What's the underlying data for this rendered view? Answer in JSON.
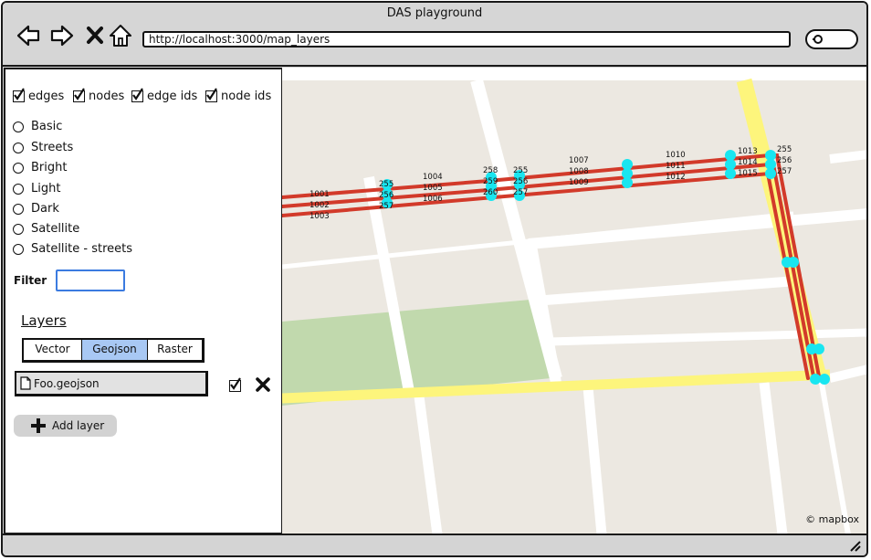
{
  "window": {
    "title": "DAS playground"
  },
  "toolbar": {
    "url": "http://localhost:3000/map_layers",
    "icons": [
      "back-arrow-icon",
      "forward-arrow-icon",
      "close-icon",
      "home-icon",
      "search-icon"
    ]
  },
  "sidebar": {
    "toggles": [
      {
        "label": "edges",
        "checked": true
      },
      {
        "label": "nodes",
        "checked": true
      },
      {
        "label": "edge ids",
        "checked": true
      },
      {
        "label": "node ids",
        "checked": true
      }
    ],
    "styles": [
      {
        "label": "Basic",
        "selected": false
      },
      {
        "label": "Streets",
        "selected": false
      },
      {
        "label": "Bright",
        "selected": false
      },
      {
        "label": "Light",
        "selected": false
      },
      {
        "label": "Dark",
        "selected": false
      },
      {
        "label": "Satellite",
        "selected": false
      },
      {
        "label": "Satellite - streets",
        "selected": false
      }
    ],
    "filter": {
      "label": "Filter",
      "value": ""
    },
    "layers": {
      "heading": "Layers",
      "tabs": [
        {
          "label": "Vector",
          "active": false
        },
        {
          "label": "Geojson",
          "active": true
        },
        {
          "label": "Raster",
          "active": false
        }
      ],
      "items": [
        {
          "name": "Foo.geojson",
          "visible": true
        }
      ],
      "add_label": "Add layer"
    }
  },
  "map": {
    "attribution": "© mapbox",
    "colors": {
      "edge": "#d23a2a",
      "node": "#19e6f0",
      "major_road": "#fdf57c",
      "park": "#c1d9ad",
      "land": "#ece8e1",
      "street": "#ffffff"
    },
    "edge_ids": {
      "west": [
        "1001",
        "1002",
        "1003"
      ],
      "mid": [
        "1004",
        "1005",
        "1006"
      ],
      "center": [
        "1007",
        "1008",
        "1009"
      ],
      "east": [
        "1010",
        "1011",
        "1012"
      ],
      "far_east": [
        "1013",
        "1014",
        "1015"
      ]
    },
    "node_ids": {
      "a": [
        "255",
        "256",
        "257"
      ],
      "b": [
        "258",
        "259",
        "260"
      ],
      "c": [
        "255",
        "256",
        "257"
      ],
      "d": [
        "255",
        "256",
        "257"
      ]
    }
  }
}
